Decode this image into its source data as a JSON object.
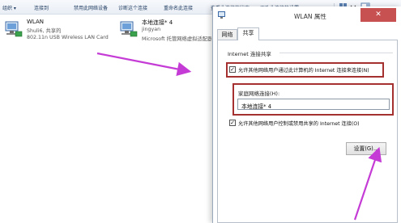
{
  "toolbar": {
    "items": [
      "组织 ▾",
      "连接到",
      "禁用此网络设备",
      "诊断这个连接",
      "重命名此连接",
      "查看此连接的状态",
      "更改此连接的设置"
    ]
  },
  "connections": [
    {
      "name": "WLAN",
      "line1": "Shuli6, 共享的",
      "line2": "802.11n USB Wireless LAN Card"
    },
    {
      "name": "本地连接* 4",
      "line1": "jingyan",
      "line2": "Microsoft 托管网络虚拟适配器"
    }
  ],
  "dialog": {
    "title": "WLAN 属性",
    "close_label": "✕",
    "tabs": [
      "网络",
      "共享"
    ],
    "active_tab": "共享",
    "group_label": "Internet 连接共享",
    "allow_share_label": "允许其他网络用户通过此计算机的 Internet 连接来连接(N)",
    "allow_share_checked": true,
    "home_network_label": "家庭网络连接(H):",
    "home_network_value": "本地连接* 4",
    "allow_control_label": "允许其他网络用户控制或禁用共享的 Internet 连接(O)",
    "allow_control_checked": true,
    "settings_button": "设置(G)..."
  },
  "colors": {
    "highlight_box": "#a4312f",
    "arrow": "#c53bd6",
    "close_button": "#c75050"
  },
  "icons": [
    "network-adapter-icon",
    "wlan-properties-icon",
    "view-options-icon",
    "close-icon",
    "checkmark-icon"
  ]
}
